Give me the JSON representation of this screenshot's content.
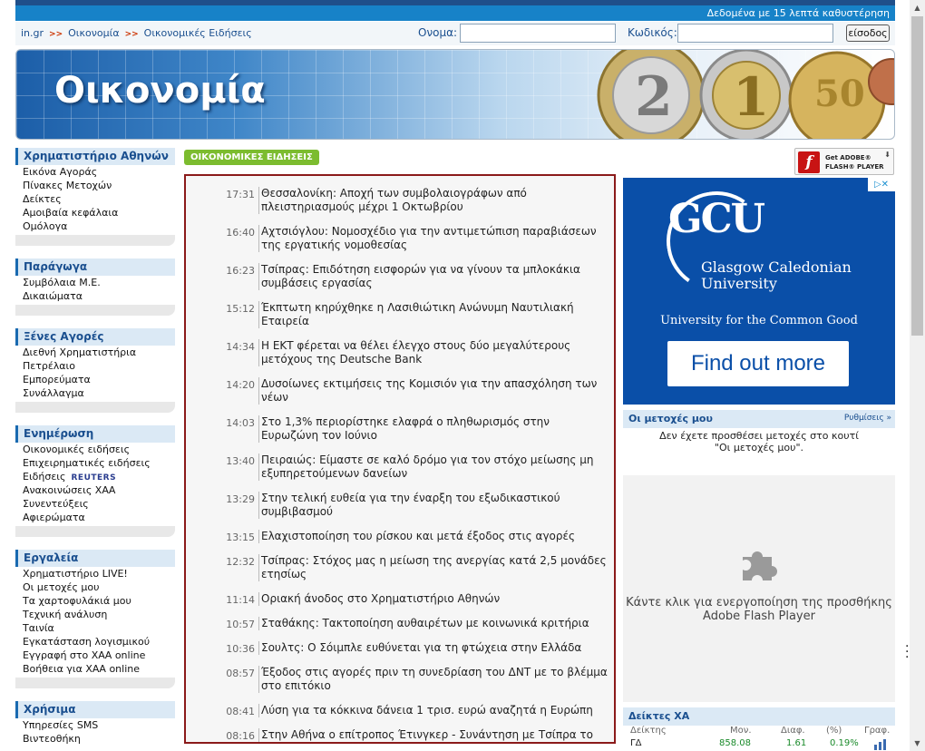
{
  "header": {
    "delay_notice": "Δεδομένα με 15 λεπτά καθυστέρηση",
    "breadcrumbs": [
      "in.gr",
      "Οικονομία",
      "Οικονομικές Ειδήσεις"
    ],
    "crumb_sep": ">>",
    "login": {
      "name_label": "Ονομα:",
      "code_label": "Κωδικός:",
      "submit_label": "είσοδος"
    }
  },
  "banner": {
    "title": "Οικονομία"
  },
  "sidebar": {
    "groups": [
      {
        "title": "Χρηματιστήριο Αθηνών",
        "items": [
          "Εικόνα Αγοράς",
          "Πίνακες Μετοχών",
          "Δείκτες",
          "Αμοιβαία κεφάλαια",
          "Ομόλογα"
        ]
      },
      {
        "title": "Παράγωγα",
        "items": [
          "Συμβόλαια Μ.Ε.",
          "Δικαιώματα"
        ]
      },
      {
        "title": "Ξένες Αγορές",
        "items": [
          "Διεθνή Χρηματιστήρια",
          "Πετρέλαιο",
          "Εμπορεύματα",
          "Συνάλλαγμα"
        ]
      },
      {
        "title": "Ενημέρωση",
        "items": [
          "Οικονομικές ειδήσεις",
          "Επιχειρηματικές ειδήσεις",
          "Ειδήσεις",
          "Ανακοινώσεις ΧΑΑ",
          "Συνεντεύξεις",
          "Αφιερώματα"
        ],
        "reuters": "REUTERS"
      },
      {
        "title": "Εργαλεία",
        "items": [
          "Χρηματιστήριο LIVE!",
          "Οι μετοχές μου",
          "Τα χαρτοφυλάκιά μου",
          "Τεχνική ανάλυση",
          "Ταινία",
          "Εγκατάσταση λογισμικού",
          "Εγγραφή στο ΧΑΑ online",
          "Βοήθεια για ΧΑΑ online"
        ]
      },
      {
        "title": "Χρήσιμα",
        "items": [
          "Υπηρεσίες SMS",
          "Βιντεοθήκη"
        ]
      }
    ]
  },
  "news": {
    "section_label": "ΟΙΚΟΝΟΜΙΚΕΣ ΕΙΔΗΣΕΙΣ",
    "items": [
      {
        "time": "17:31",
        "title": "Θεσσαλονίκη: Αποχή των συμβολαιογράφων από πλειστηριασμούς μέχρι 1 Οκτωβρίου"
      },
      {
        "time": "16:40",
        "title": "Αχτσιόγλου: Νομοσχέδιο για την αντιμετώπιση παραβιάσεων της εργατικής νομοθεσίας"
      },
      {
        "time": "16:23",
        "title": "Τσίπρας: Επιδότηση εισφορών για να γίνουν τα μπλοκάκια συμβάσεις εργασίας"
      },
      {
        "time": "15:12",
        "title": "Έκπτωτη κηρύχθηκε η Λασιθιώτικη Ανώνυμη Ναυτιλιακή Εταιρεία"
      },
      {
        "time": "14:34",
        "title": "Η ΕΚΤ φέρεται να θέλει έλεγχο στους δύο μεγαλύτερους μετόχους της Deutsche Bank"
      },
      {
        "time": "14:20",
        "title": "Δυσοίωνες εκτιμήσεις της Κομισιόν για την απασχόληση των νέων"
      },
      {
        "time": "14:03",
        "title": "Στο 1,3% περιορίστηκε ελαφρά ο πληθωρισμός στην Ευρωζώνη τον Ιούνιο"
      },
      {
        "time": "13:40",
        "title": "Πειραιώς: Είμαστε σε καλό δρόμο για τον στόχο μείωσης μη εξυπηρετούμενων δανείων"
      },
      {
        "time": "13:29",
        "title": "Στην τελική ευθεία για την έναρξη του εξωδικαστικού συμβιβασμού"
      },
      {
        "time": "13:15",
        "title": "Ελαχιστοποίηση του ρίσκου και μετά έξοδος στις αγορές"
      },
      {
        "time": "12:32",
        "title": "Τσίπρας: Στόχος μας η μείωση της ανεργίας κατά 2,5 μονάδες ετησίως"
      },
      {
        "time": "11:14",
        "title": "Οριακή άνοδος στο Χρηματιστήριο Αθηνών"
      },
      {
        "time": "10:57",
        "title": "Σταθάκης: Τακτοποίηση αυθαιρέτων με κοινωνικά κριτήρια"
      },
      {
        "time": "10:36",
        "title": "Σουλτς: Ο Σόιμπλε ευθύνεται για τη φτώχεια στην Ελλάδα"
      },
      {
        "time": "08:57",
        "title": "Έξοδος στις αγορές πριν τη συνεδρίαση του ΔΝΤ με το βλέμμα στο επιτόκιο"
      },
      {
        "time": "08:41",
        "title": "Λύση για τα κόκκινα δάνεια 1 τρισ. ευρώ αναζητά η Ευρώπη"
      },
      {
        "time": "08:16",
        "title": "Στην Αθήνα ο επίτροπος Έτινγκερ - Συνάντηση με Τσίπρα το μεσημέρι"
      }
    ]
  },
  "flash_badge": {
    "line1": "Get ADOBE®",
    "line2": "FLASH® PLAYER"
  },
  "ad": {
    "brand": "GCU",
    "name_line1": "Glasgow Caledonian",
    "name_line2": "University",
    "tagline": "University for the Common Good",
    "cta": "Find out more"
  },
  "my_stocks": {
    "title": "Οι μετοχές μου",
    "settings_label": "Ρυθμίσεις »",
    "empty_line1": "Δεν έχετε προσθέσει μετοχές στο κουτί",
    "empty_line2": "\"Οι μετοχές μου\"."
  },
  "flash_plugin": {
    "message_line1": "Κάντε κλικ για ενεργοποίηση της προσθήκης",
    "message_line2": "Adobe Flash Player"
  },
  "indices": {
    "title": "Δείκτες ΧΑ",
    "columns": [
      "Δείκτης",
      "Μον.",
      "Διαφ.",
      "(%)",
      "Γραφ."
    ],
    "rows": [
      {
        "name": "ΓΔ",
        "value": "858.08",
        "change": "1.61",
        "pct": "0.19%"
      }
    ]
  },
  "colors": {
    "accent": "#1782c8",
    "news_border": "#8b1a1a",
    "tag_green": "#7cbc2f",
    "ad_blue": "#0a4fa8"
  }
}
